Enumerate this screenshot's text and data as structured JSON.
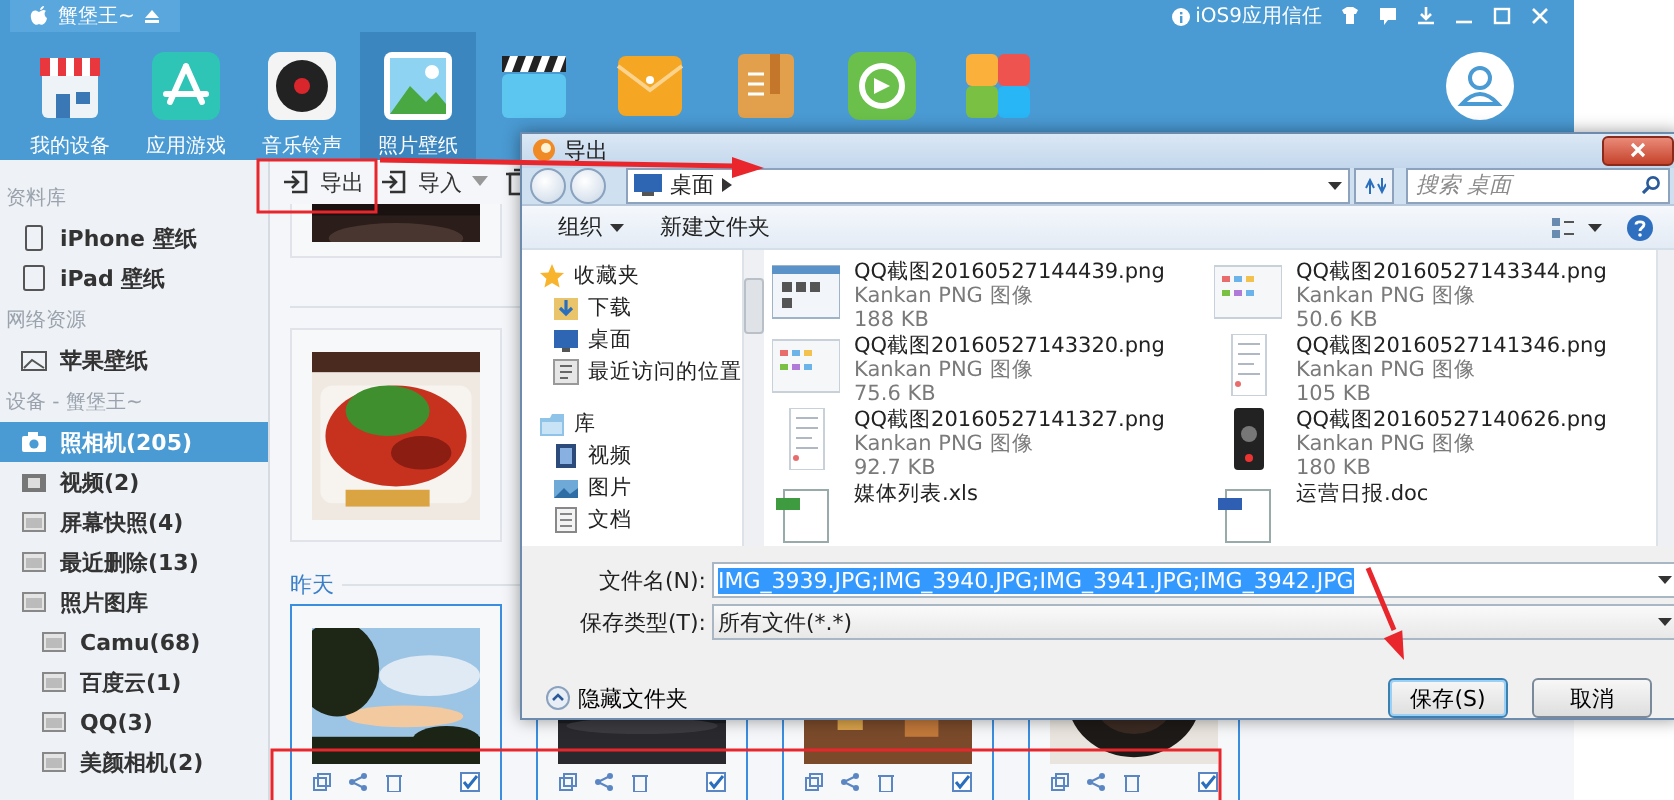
{
  "app": {
    "device_tab": "蟹堡王~",
    "trust_label": "iOS9应用信任",
    "nav": [
      {
        "label": "我的设备",
        "selected": false
      },
      {
        "label": "应用游戏",
        "selected": false
      },
      {
        "label": "音乐铃声",
        "selected": false
      },
      {
        "label": "照片壁纸",
        "selected": true
      },
      {
        "selected": false
      },
      {
        "selected": false
      },
      {
        "selected": false
      },
      {
        "selected": false
      },
      {
        "selected": false
      },
      {
        "selected": false
      }
    ],
    "sidebar": [
      {
        "kind": "header",
        "label": "资料库"
      },
      {
        "kind": "item",
        "label": "iPhone 壁纸",
        "selected": false
      },
      {
        "kind": "item",
        "label": "iPad 壁纸",
        "selected": false
      },
      {
        "kind": "header",
        "label": "网络资源"
      },
      {
        "kind": "item",
        "label": "苹果壁纸",
        "selected": false
      },
      {
        "kind": "header",
        "label": "设备 - 蟹堡王~"
      },
      {
        "kind": "item",
        "label": "照相机(205)",
        "selected": true
      },
      {
        "kind": "item",
        "label": "视频(2)",
        "selected": false
      },
      {
        "kind": "item",
        "label": "屏幕快照(4)",
        "selected": false
      },
      {
        "kind": "item",
        "label": "最近删除(13)",
        "selected": false
      },
      {
        "kind": "item",
        "label": "照片图库",
        "selected": false,
        "children": [
          {
            "kind": "item",
            "label": "Camu(68)",
            "selected": false
          },
          {
            "kind": "item",
            "label": "百度云(1)",
            "selected": false
          },
          {
            "kind": "item",
            "label": "QQ(3)",
            "selected": false
          },
          {
            "kind": "item",
            "label": "美颜相机(2)",
            "selected": false
          }
        ]
      }
    ],
    "toolbar": [
      {
        "label": "导出",
        "dropdown": false
      },
      {
        "label": "导入",
        "dropdown": true
      }
    ],
    "top_photos": [
      {
        "kind": "picture",
        "selected": false
      },
      {
        "kind": "picture",
        "selected": false
      }
    ],
    "section_label": "昨天",
    "photos": [
      {
        "kind": "picture",
        "selected": true,
        "checked": true
      },
      {
        "kind": "picture",
        "selected": true,
        "checked": true
      },
      {
        "kind": "picture",
        "selected": true,
        "checked": true
      },
      {
        "kind": "picture",
        "selected": true,
        "checked": true
      }
    ]
  },
  "dialog": {
    "title": "导出",
    "location": "桌面",
    "search_placeholder": "搜索 桌面",
    "commands": [
      {
        "label": "组织",
        "dropdown": true
      },
      {
        "label": "新建文件夹",
        "dropdown": false
      }
    ],
    "nav_pane": [
      {
        "label": "收藏夹",
        "children": [
          {
            "label": "下载"
          },
          {
            "label": "桌面"
          },
          {
            "label": "最近访问的位置"
          }
        ]
      },
      {
        "label": "库",
        "children": [
          {
            "label": "视频"
          },
          {
            "label": "图片"
          },
          {
            "label": "文档"
          }
        ]
      }
    ],
    "files": [
      {
        "name": "QQ截图20160527144439.png",
        "type": "Kankan PNG 图像",
        "size": "188 KB"
      },
      {
        "name": "QQ截图20160527143344.png",
        "type": "Kankan PNG 图像",
        "size": "50.6 KB"
      },
      {
        "name": "QQ截图20160527143320.png",
        "type": "Kankan PNG 图像",
        "size": "75.6 KB"
      },
      {
        "name": "QQ截图20160527141346.png",
        "type": "Kankan PNG 图像",
        "size": "105 KB"
      },
      {
        "name": "QQ截图20160527141327.png",
        "type": "Kankan PNG 图像",
        "size": "92.7 KB"
      },
      {
        "name": "QQ截图20160527140626.png",
        "type": "Kankan PNG 图像",
        "size": "180 KB"
      },
      {
        "name": "媒体列表.xls"
      },
      {
        "name": "运营日报.doc"
      }
    ],
    "file_name_label": "文件名(N):",
    "file_name": "IMG_3939.JPG;IMG_3940.JPG;IMG_3941.JPG;IMG_3942.JPG",
    "file_type_label": "保存类型(T):",
    "file_type": "所有文件(*.*)",
    "hide_folders": "隐藏文件夹",
    "buttons": [
      {
        "label": "保存(S)",
        "default": true
      },
      {
        "label": "取消",
        "default": false
      }
    ]
  }
}
